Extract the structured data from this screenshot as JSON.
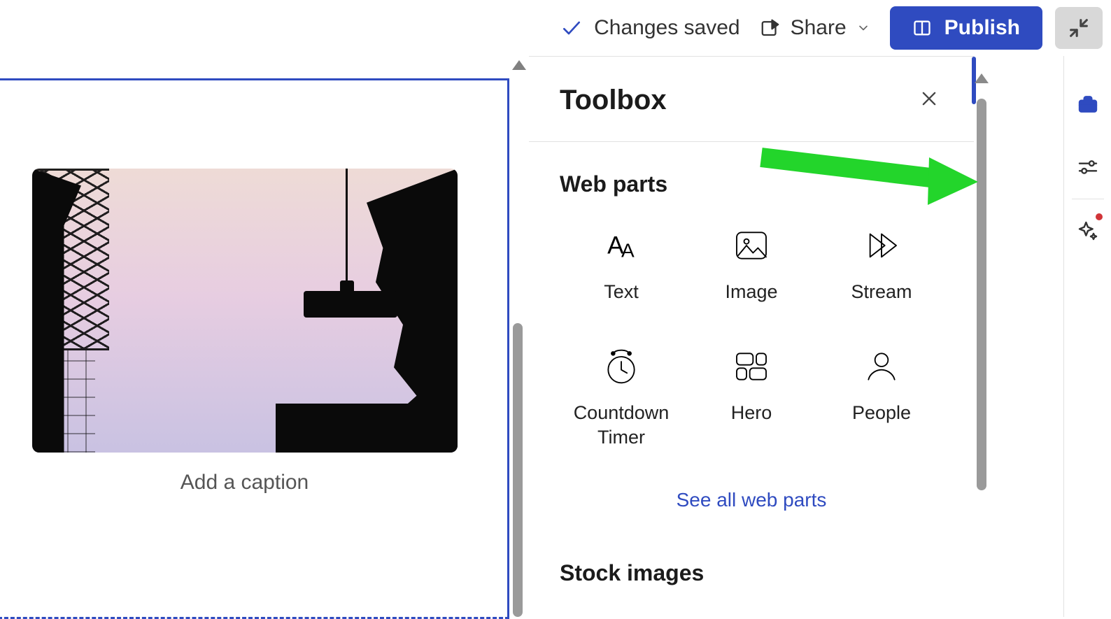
{
  "topbar": {
    "status_label": "Changes saved",
    "share_label": "Share",
    "publish_label": "Publish"
  },
  "canvas": {
    "image_webpart": {
      "caption_placeholder": "Add a caption"
    }
  },
  "toolbox": {
    "title": "Toolbox",
    "section_web_parts": "Web parts",
    "see_all_label": "See all web parts",
    "section_stock_images": "Stock images",
    "web_parts": [
      {
        "icon": "text-icon",
        "label": "Text"
      },
      {
        "icon": "image-icon",
        "label": "Image"
      },
      {
        "icon": "stream-icon",
        "label": "Stream"
      },
      {
        "icon": "countdown-timer-icon",
        "label": "Countdown Timer"
      },
      {
        "icon": "hero-icon",
        "label": "Hero"
      },
      {
        "icon": "people-icon",
        "label": "People"
      }
    ]
  },
  "rail": {
    "items": [
      {
        "name": "toolbox",
        "active": true
      },
      {
        "name": "settings",
        "active": false
      },
      {
        "name": "copilot",
        "active": false,
        "badge": true
      }
    ]
  }
}
